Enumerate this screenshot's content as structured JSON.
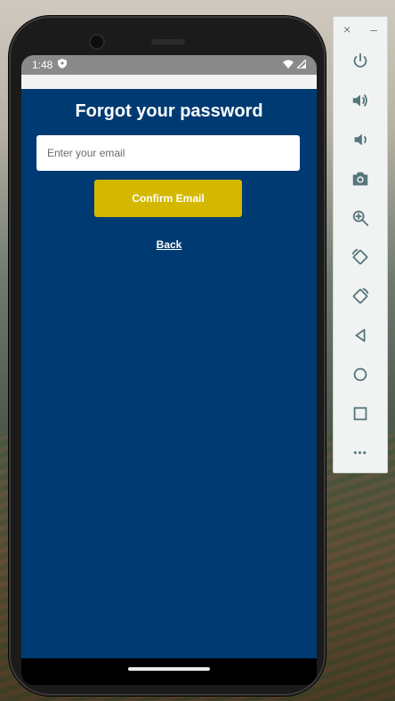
{
  "status_bar": {
    "time": "1:48",
    "icons": [
      "shield-icon",
      "wifi-icon",
      "signal-icon"
    ]
  },
  "screen": {
    "title": "Forgot your password",
    "email_placeholder": "Enter your email",
    "email_value": "",
    "confirm_label": "Confirm Email",
    "back_label": "Back",
    "colors": {
      "background": "#003a72",
      "button": "#d4b800",
      "text": "#ffffff"
    }
  },
  "emulator_toolbar": {
    "close_label": "×",
    "minimize_label": "–",
    "tools": [
      "power-icon",
      "volume-up-icon",
      "volume-down-icon",
      "camera-icon",
      "zoom-icon",
      "rotate-left-icon",
      "rotate-right-icon",
      "back-icon",
      "home-icon",
      "overview-icon",
      "more-icon"
    ],
    "more_label": "•••"
  }
}
